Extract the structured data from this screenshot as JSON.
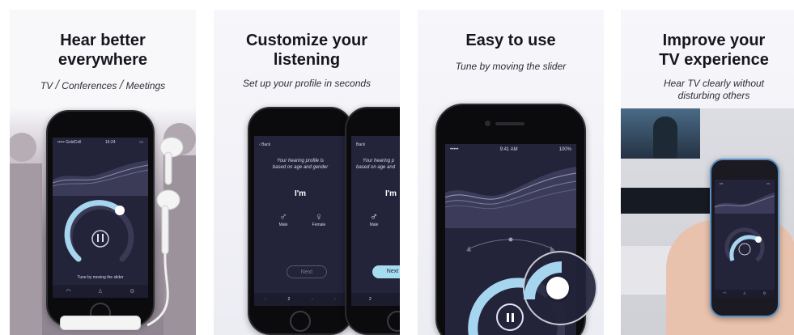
{
  "panels": [
    {
      "title_line1": "Hear better",
      "title_line2": "everywhere",
      "tags": [
        "TV",
        "Conferences",
        "Meetings"
      ],
      "screen": {
        "carrier": "••••• GoldCell",
        "time": "16:24",
        "hint": "Tune by moving the slider"
      }
    },
    {
      "title_line1": "Customize your",
      "title_line2": "listening",
      "subtitle": "Set up your profile in seconds",
      "screen": {
        "back_label": "Back",
        "profile_text_line1": "Your hearing profile is",
        "profile_text_line2": "based on age and gender",
        "im_label": "I'm",
        "male_label": "Male",
        "female_label": "Female",
        "next_label": "Next",
        "page_number": "2",
        "second_back_label": "Back",
        "second_profile_line1": "Your hearing p",
        "second_profile_line2": "based on age and",
        "second_im_label": "I'm",
        "second_male_label": "Male",
        "second_next_label": "Next",
        "second_page_number": "2"
      }
    },
    {
      "title": "Easy to use",
      "subtitle": "Tune by moving the slider",
      "screen": {
        "carrier": "•••••",
        "time": "9:41 AM",
        "battery": "100%"
      }
    },
    {
      "title_line1": "Improve your",
      "title_line2": "TV experience",
      "subtitle_line1": "Hear TV clearly without",
      "subtitle_line2": "disturbing others"
    }
  ],
  "colors": {
    "screen_bg": "#23233a",
    "accent": "#9fd3ec",
    "accent_dark": "#5f9bd0",
    "title": "#16161d"
  },
  "icons": [
    "pause-icon",
    "headphones-icon",
    "person-icon",
    "gear-icon",
    "back-chevron-icon",
    "male-icon",
    "female-icon",
    "earbuds-icon"
  ]
}
